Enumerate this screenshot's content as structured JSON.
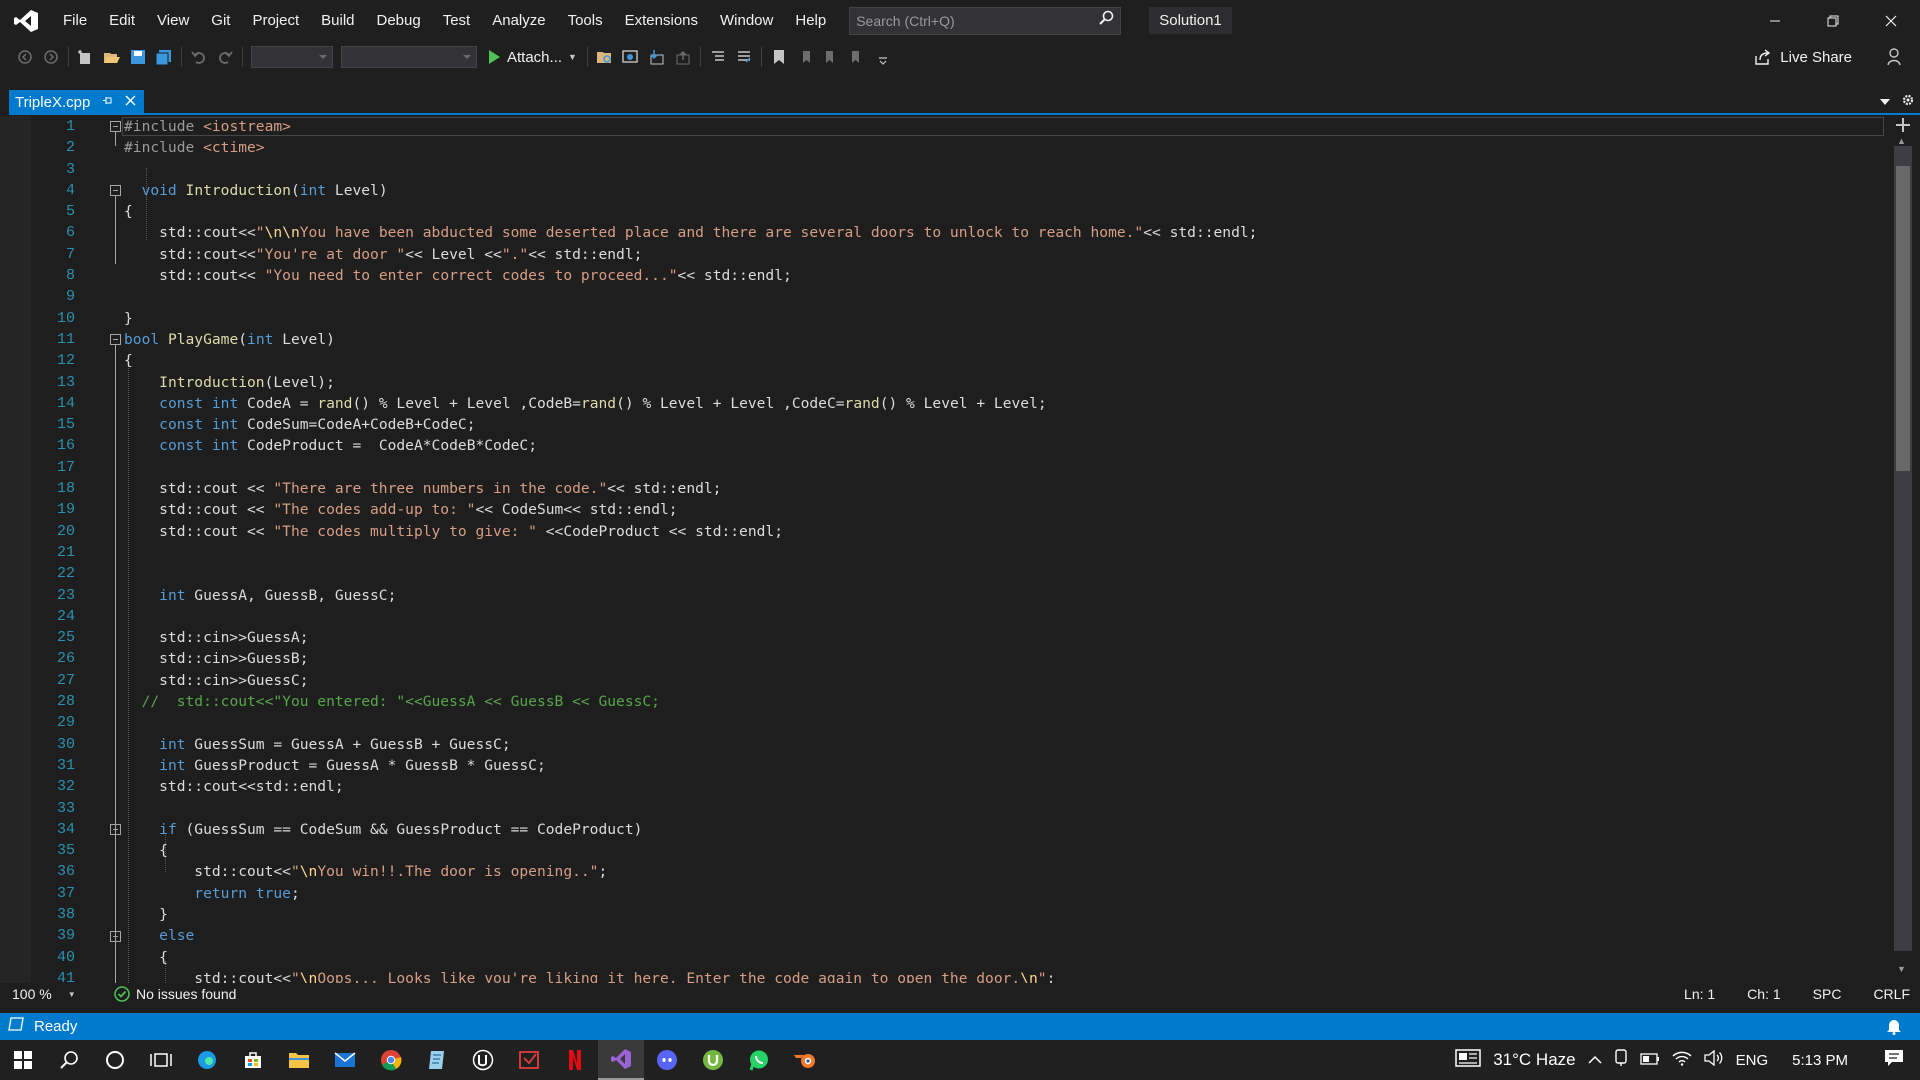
{
  "menu": {
    "items": [
      "File",
      "Edit",
      "View",
      "Git",
      "Project",
      "Build",
      "Debug",
      "Test",
      "Analyze",
      "Tools",
      "Extensions",
      "Window",
      "Help"
    ],
    "search_placeholder": "Search (Ctrl+Q)",
    "solution_name": "Solution1"
  },
  "toolbar": {
    "attach_label": "Attach...",
    "live_share_label": "Live Share"
  },
  "tab": {
    "filename": "TripleX.cpp"
  },
  "editor": {
    "line_numbers": [
      "1",
      "2",
      "3",
      "4",
      "5",
      "6",
      "7",
      "8",
      "9",
      "10",
      "11",
      "12",
      "13",
      "14",
      "15",
      "16",
      "17",
      "18",
      "19",
      "20",
      "21",
      "22",
      "23",
      "24",
      "25",
      "26",
      "27",
      "28",
      "29",
      "30",
      "31",
      "32",
      "33",
      "34",
      "35",
      "36",
      "37",
      "38",
      "39",
      "40",
      "41"
    ]
  },
  "footer": {
    "zoom": "100 %",
    "issues": "No issues found",
    "line": "Ln: 1",
    "col": "Ch: 1",
    "spc": "SPC",
    "eol": "CRLF"
  },
  "status": {
    "text": "Ready"
  },
  "tray": {
    "weather": "31°C  Haze",
    "lang": "ENG",
    "time": "5:13 PM"
  },
  "colors": {
    "accent": "#007acc",
    "keyword": "#569cd6",
    "string": "#d69d85",
    "comment": "#57a64a",
    "line_number": "#2b91af"
  }
}
